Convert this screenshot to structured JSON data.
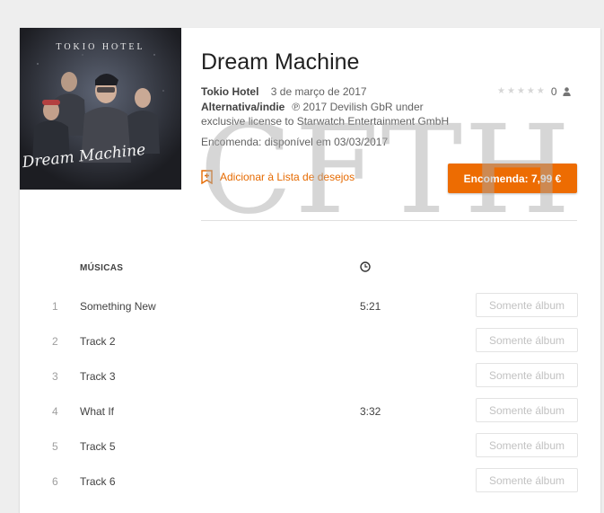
{
  "album": {
    "title": "Dream Machine",
    "artist": "Tokio Hotel",
    "release_date": "3 de março de 2017",
    "genre": "Alternativa/indie",
    "copyright": "℗ 2017 Devilish GbR under exclusive license to Starwatch Entertainment GmbH",
    "preorder_note": "Encomenda: disponível em 03/03/2017",
    "rating_count": "0",
    "cover": {
      "band_name": "TOKIO HOTEL",
      "script_title": "Dream Machine"
    }
  },
  "actions": {
    "wishlist_label": "Adicionar à Lista de desejos",
    "buy_label": "Encomenda: 7,99 €"
  },
  "tracks_header": {
    "title_label": "MÚSICAS"
  },
  "watermark": "CFTH",
  "tracks": [
    {
      "num": "1",
      "title": "Something New",
      "duration": "5:21",
      "button": "Somente álbum"
    },
    {
      "num": "2",
      "title": "Track 2",
      "duration": "",
      "button": "Somente álbum"
    },
    {
      "num": "3",
      "title": "Track 3",
      "duration": "",
      "button": "Somente álbum"
    },
    {
      "num": "4",
      "title": "What If",
      "duration": "3:32",
      "button": "Somente álbum"
    },
    {
      "num": "5",
      "title": "Track 5",
      "duration": "",
      "button": "Somente álbum"
    },
    {
      "num": "6",
      "title": "Track 6",
      "duration": "",
      "button": "Somente álbum"
    }
  ],
  "colors": {
    "accent": "#ed6c02",
    "wishlist": "#e66a00",
    "text": "#212121",
    "muted": "#9e9e9e"
  }
}
